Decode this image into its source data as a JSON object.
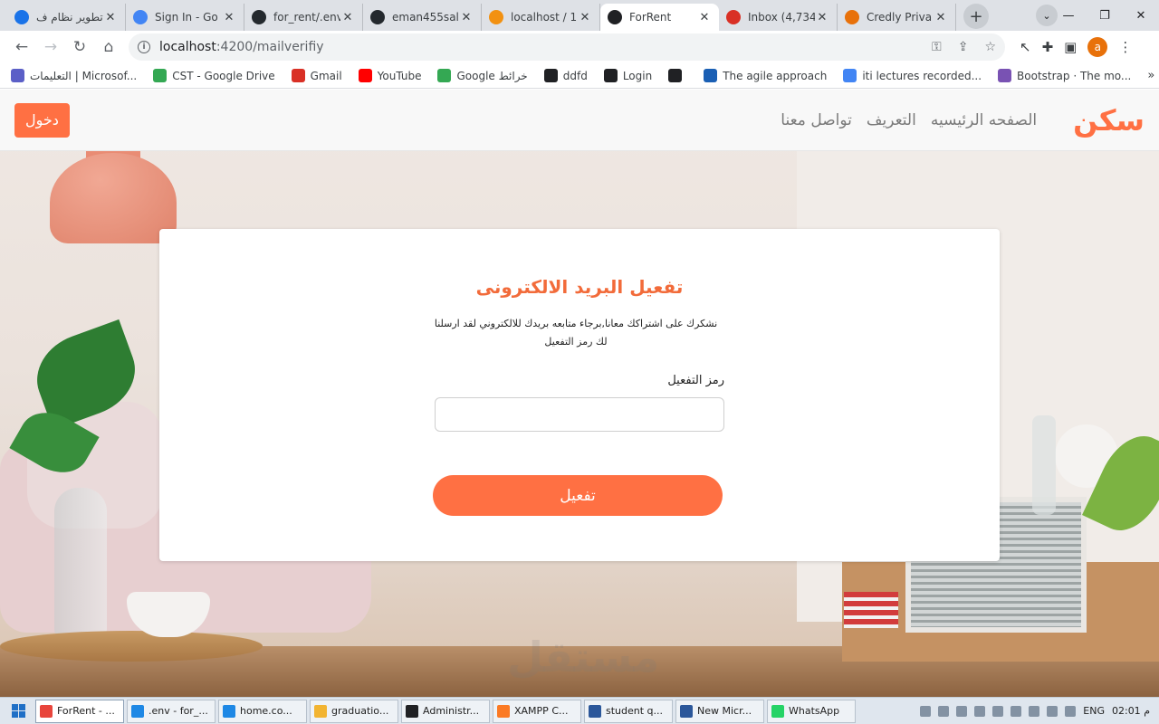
{
  "browser": {
    "tabs": [
      {
        "title": "تطوير نظام ف",
        "icon": "chrome-blue-icon",
        "color": "#1a73e8"
      },
      {
        "title": "Sign In - Go",
        "icon": "google-icon",
        "color": "#4285f4"
      },
      {
        "title": "for_rent/.env",
        "icon": "github-icon",
        "color": "#24292e"
      },
      {
        "title": "eman455sall",
        "icon": "github-icon",
        "color": "#24292e"
      },
      {
        "title": "localhost / 1",
        "icon": "phpmyadmin-icon",
        "color": "#f29111"
      },
      {
        "title": "ForRent",
        "icon": "angular-icon",
        "color": "#202124",
        "active": true
      },
      {
        "title": "Inbox (4,734",
        "icon": "gmail-icon",
        "color": "#d93025"
      },
      {
        "title": "Credly Priva",
        "icon": "credly-icon",
        "color": "#e8710a"
      }
    ],
    "url_host": "localhost",
    "url_path": ":4200/mailverifiy",
    "profile_initial": "a",
    "bookmarks": [
      {
        "label": "التعليمات | Microsof...",
        "icon": "teams-icon",
        "color": "#5b5fc7"
      },
      {
        "label": "CST - Google Drive",
        "icon": "drive-icon",
        "color": "#34a853"
      },
      {
        "label": "Gmail",
        "icon": "gmail-icon",
        "color": "#d93025"
      },
      {
        "label": "YouTube",
        "icon": "youtube-icon",
        "color": "#ff0000"
      },
      {
        "label": "Google خرائط",
        "icon": "maps-icon",
        "color": "#34a853"
      },
      {
        "label": "ddfd",
        "icon": "globe-icon",
        "color": "#202124"
      },
      {
        "label": "Login",
        "icon": "globe-icon",
        "color": "#202124"
      },
      {
        "label": "",
        "icon": "globe-icon",
        "color": "#202124"
      },
      {
        "label": "The agile approach",
        "icon": "video-icon",
        "color": "#1a5fb4"
      },
      {
        "label": "iti lectures recorded...",
        "icon": "docs-icon",
        "color": "#4285f4"
      },
      {
        "label": "Bootstrap · The mo...",
        "icon": "bootstrap-icon",
        "color": "#7952b3"
      }
    ]
  },
  "site": {
    "brand": "سكن",
    "nav_links": [
      "الصفحه الرئيسيه",
      "التعريف",
      "تواصل معنا"
    ],
    "login_label": "دخول",
    "accent_color": "#ff7043"
  },
  "card": {
    "title": "تفعيل البريد الالكترونى",
    "message": "نشكرك على اشتراكك معانا,برجاء متابعه بريدك للالكتروني لقد ارسلنا لك رمز التفعيل",
    "code_label": "رمز التفعيل",
    "code_value": "",
    "button_label": "تفعيل"
  },
  "watermark": "مستقل",
  "taskbar": {
    "items": [
      {
        "label": "ForRent - ...",
        "icon": "chrome-icon",
        "color": "#e8453c",
        "active": true
      },
      {
        "label": ".env - for_...",
        "icon": "vscode-icon",
        "color": "#1e88e5"
      },
      {
        "label": "home.co...",
        "icon": "vscode-icon",
        "color": "#1e88e5"
      },
      {
        "label": "graduatio...",
        "icon": "folder-icon",
        "color": "#f2b431"
      },
      {
        "label": "Administr...",
        "icon": "cmd-icon",
        "color": "#202124"
      },
      {
        "label": "XAMPP C...",
        "icon": "xampp-icon",
        "color": "#fb7a24"
      },
      {
        "label": "student q...",
        "icon": "word-icon",
        "color": "#2b579a"
      },
      {
        "label": "New Micr...",
        "icon": "word-icon",
        "color": "#2b579a"
      },
      {
        "label": "WhatsApp",
        "icon": "whatsapp-icon",
        "color": "#25d366"
      }
    ],
    "language": "ENG",
    "clock": "02:01 م"
  }
}
